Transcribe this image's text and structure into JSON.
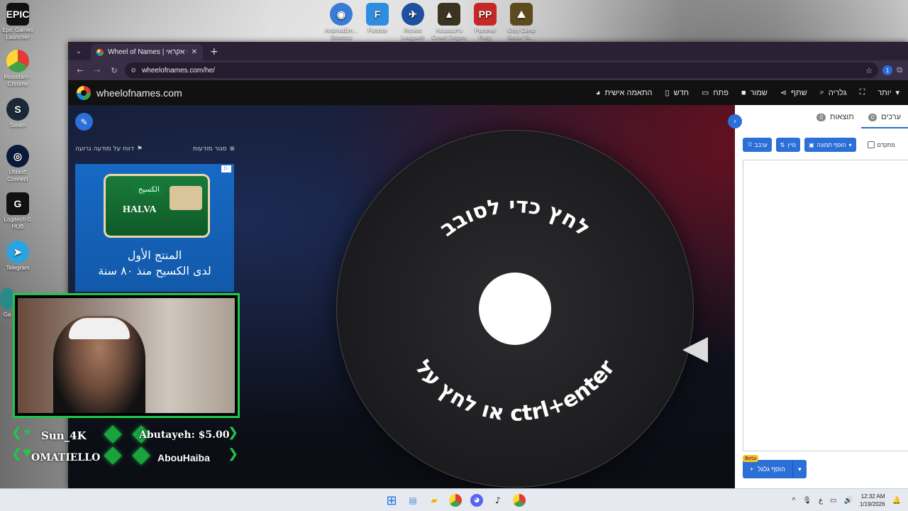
{
  "desktop": {
    "left_icons": [
      {
        "label": "Epic Games Launcher",
        "icon": "epic-icon",
        "color": "#111111"
      },
      {
        "label": "Musallam - Chrome",
        "icon": "chrome-icon",
        "color": "#e53935"
      },
      {
        "label": "Steam",
        "icon": "steam-icon",
        "color": "#1b2838"
      },
      {
        "label": "Ubisoft Connect",
        "icon": "ubisoft-icon",
        "color": "#0b1a3a"
      },
      {
        "label": "Logitech G HUB",
        "icon": "logitech-icon",
        "color": "#111111"
      },
      {
        "label": "Telegram",
        "icon": "telegram-icon",
        "color": "#2aa3e0"
      }
    ],
    "top_icons": [
      {
        "label": "AndroidEm... Shortcut",
        "icon": "android-emulator-icon",
        "color": "#3a7bd5"
      },
      {
        "label": "Fortnite",
        "icon": "fortnite-icon",
        "color": "#2e8de0"
      },
      {
        "label": "Rocket League®",
        "icon": "rocket-league-icon",
        "color": "#1f4fa0"
      },
      {
        "label": "Assassin's Creed Origins",
        "icon": "assassins-creed-icon",
        "color": "#3b3220"
      },
      {
        "label": "Pummel Party",
        "icon": "pummel-party-icon",
        "color": "#c62828"
      },
      {
        "label": "Only Climb Better To...",
        "icon": "only-climb-icon",
        "color": "#5d4a1f"
      }
    ],
    "partial_label": "Ga"
  },
  "browser": {
    "tab_title": "Wheel of Names | גלגל שם אקראי",
    "url": "wheelofnames.com/he/",
    "extension_badge": "1"
  },
  "site": {
    "brand": "wheelofnames.com",
    "menu": [
      {
        "label": "יותר",
        "icon": "chevron-down-icon"
      },
      {
        "label": "",
        "icon": "fullscreen-icon"
      },
      {
        "label": "גלריה",
        "icon": "search-icon"
      },
      {
        "label": "שתף",
        "icon": "share-icon"
      },
      {
        "label": "שמור",
        "icon": "save-icon"
      },
      {
        "label": "פתח",
        "icon": "folder-icon"
      },
      {
        "label": "חדש",
        "icon": "file-icon"
      },
      {
        "label": "התאמה אישית",
        "icon": "palette-icon"
      }
    ],
    "ad_report": "דווח על מודעה גרועה",
    "ad_close": "סגור מודעות",
    "ad": {
      "product_brand": "الكسيح",
      "product_name": "HALVA",
      "line1": "المنتج الأول",
      "line2": "لدى الكسيح منذ ٨٠ سنة"
    },
    "wheel": {
      "top_text": "לחץ כדי לסובב",
      "bottom_text": "או לחץ על ctrl+enter"
    },
    "panel": {
      "tabs": [
        {
          "label": "ערכים",
          "count": "0"
        },
        {
          "label": "תוצאות",
          "count": "0"
        }
      ],
      "buttons": {
        "shuffle": "ערבב",
        "sort": "מיין",
        "add_image": "הוסף תמונה",
        "advanced": "מתקדם"
      },
      "add_wheel": "הוסף גלגל",
      "beta": "Beta"
    }
  },
  "webcam": {
    "labels": [
      {
        "text": "Sun_4K"
      },
      {
        "text": "Abutayeh: $5.00"
      },
      {
        "text": "OMATIELLO"
      },
      {
        "text": "AbouHaiba"
      }
    ]
  },
  "taskbar": {
    "apps": [
      "windows-start-icon",
      "widgets-icon",
      "file-explorer-icon",
      "chrome-icon",
      "discord-icon",
      "tiktok-icon",
      "chrome-profile-icon"
    ],
    "time": "12:32 AM",
    "date": "1/19/2026",
    "lang": "ع"
  }
}
